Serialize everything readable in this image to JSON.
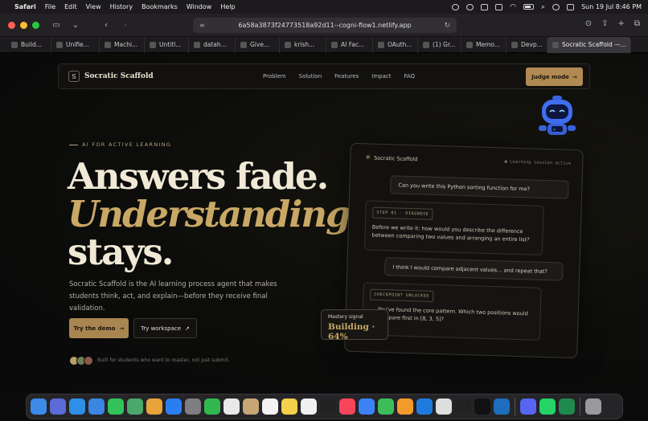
{
  "menubar": {
    "app_name": "Safari",
    "menus": [
      "File",
      "Edit",
      "View",
      "History",
      "Bookmarks",
      "Window",
      "Help"
    ],
    "clock": "Sun 19 Jul  8:46 PM"
  },
  "toolbar": {
    "url": "6a58a3873f24773518a92d11--cogni-flow1.netlify.app"
  },
  "tabs": [
    {
      "label": "Build...",
      "icon": "build-favicon"
    },
    {
      "label": "Unifie...",
      "icon": "unified-favicon"
    },
    {
      "label": "Machi...",
      "icon": "machine-favicon"
    },
    {
      "label": "Untitl...",
      "icon": "untitled-favicon"
    },
    {
      "label": "datah...",
      "icon": "github-favicon"
    },
    {
      "label": "Give...",
      "icon": "give-favicon"
    },
    {
      "label": "krish...",
      "icon": "github-favicon"
    },
    {
      "label": "AI Fac...",
      "icon": "ai-favicon"
    },
    {
      "label": "OAuth...",
      "icon": "github-favicon"
    },
    {
      "label": "(1) Gr...",
      "icon": "x-favicon"
    },
    {
      "label": "Memo...",
      "icon": "memo-favicon"
    },
    {
      "label": "Devp...",
      "icon": "dev-favicon"
    },
    {
      "label": "Socratic Scaffold —...",
      "icon": "notion-favicon",
      "active": true
    }
  ],
  "nav": {
    "brand_mark": "S",
    "brand_name": "Socratic Scaffold",
    "links": [
      "Problem",
      "Solution",
      "Features",
      "Impact",
      "FAQ"
    ],
    "cta": "Judge mode",
    "cta_arrow": "→"
  },
  "hero": {
    "eyebrow": "AI FOR ACTIVE LEARNING",
    "headline_1": "Answers fade.",
    "headline_2": "Understanding",
    "headline_3": "stays.",
    "lede": "Socratic Scaffold is the AI learning process agent that makes students think, act, and explain—before they receive final validation.",
    "primary_cta": "Try the demo",
    "primary_arrow": "→",
    "secondary_cta": "Try workspace",
    "secondary_arrow": "↗",
    "footnote": "Built for students who want to master, not just submit."
  },
  "panel": {
    "title": "Socratic Scaffold",
    "status": "● Learning session active",
    "user_msg_1": "Can you write this Python sorting function for me?",
    "step_tag": "STEP 01 · DIAGNOSE",
    "ai_msg_1": "Before we write it: how would you describe the difference between comparing two values and arranging an entire list?",
    "user_msg_2": "I think I would compare adjacent values… and repeat that?",
    "checkpoint_tag": "CHECKPOINT UNLOCKED",
    "ai_msg_2": "You've found the core pattern. Which two positions would compare first in [8, 3, 5]?"
  },
  "mastery": {
    "label": "Mastery signal",
    "value": "Building · 64%"
  },
  "colors": {
    "accent_gold": "#c9a866",
    "button_gold": "#b08a52",
    "cream": "#f0e9d6",
    "bg": "#0c0c0b"
  }
}
